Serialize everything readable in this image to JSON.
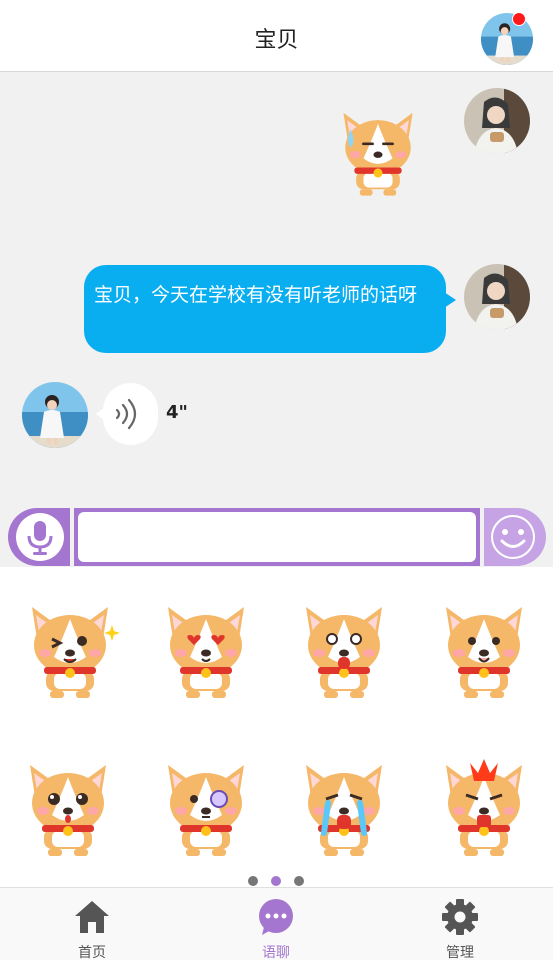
{
  "header": {
    "title": "宝贝"
  },
  "chat": {
    "messages": [
      {
        "from": "me",
        "kind": "sticker",
        "sticker": "corgi-sweat"
      },
      {
        "from": "me",
        "kind": "text",
        "text": "宝贝，今天在学校有没有听老师的话呀"
      },
      {
        "from": "child",
        "kind": "voice",
        "duration": "4\""
      }
    ]
  },
  "input": {
    "placeholder": "",
    "value": ""
  },
  "sticker_panel": {
    "stickers": [
      "corgi-wink",
      "corgi-heart-eyes",
      "corgi-shocked",
      "corgi-happy",
      "corgi-surprised",
      "corgi-monocle",
      "corgi-crying",
      "corgi-angry"
    ],
    "page_count": 3,
    "active_page": 2
  },
  "tabbar": {
    "tabs": [
      {
        "label": "首页",
        "icon": "home-icon",
        "active": false
      },
      {
        "label": "语聊",
        "icon": "chat-icon",
        "active": true
      },
      {
        "label": "管理",
        "icon": "gear-icon",
        "active": false
      }
    ]
  },
  "colors": {
    "accent": "#a476cf",
    "accent_light": "#c6a3e5",
    "bubble": "#09aef0",
    "notification": "#ff1a1a",
    "tab_inactive": "#555555"
  }
}
